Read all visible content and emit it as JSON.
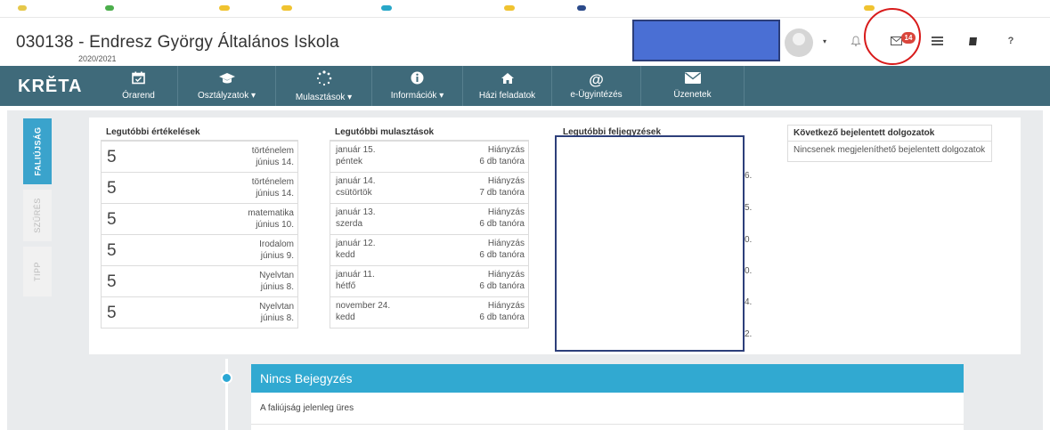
{
  "header": {
    "school_title": "030138 - Endresz György Általános Iskola",
    "school_year": "2020/2021",
    "avatar_caret": "▾",
    "message_badge": "14",
    "help_label": "?"
  },
  "nav": {
    "logo": "KRĔTA",
    "items": [
      {
        "label": "Órarend",
        "icon": "📅"
      },
      {
        "label": "Osztályzatok ▾",
        "icon": "🎓"
      },
      {
        "label": "Mulasztások ▾",
        "icon": "⁘"
      },
      {
        "label": "Információk ▾",
        "icon": "ℹ"
      },
      {
        "label": "Házi feladatok",
        "icon": "⌂"
      },
      {
        "label": "e-Ügyintézés",
        "icon": "@"
      },
      {
        "label": "Üzenetek",
        "icon": "✉"
      }
    ]
  },
  "sidetabs": {
    "active": "FALIÚJSÁG",
    "second": "SZŰRÉS",
    "third": "TIPP"
  },
  "grades": {
    "title": "Legutóbbi értékelések",
    "rows": [
      {
        "grade": "5",
        "subject": "történelem",
        "date": "június 14."
      },
      {
        "grade": "5",
        "subject": "történelem",
        "date": "június 14."
      },
      {
        "grade": "5",
        "subject": "matematika",
        "date": "június 10."
      },
      {
        "grade": "5",
        "subject": "Irodalom",
        "date": "június 9."
      },
      {
        "grade": "5",
        "subject": "Nyelvtan",
        "date": "június 8."
      },
      {
        "grade": "5",
        "subject": "Nyelvtan",
        "date": "június 8."
      }
    ]
  },
  "absences": {
    "title": "Legutóbbi mulasztások",
    "rows": [
      {
        "date": "január 15.",
        "day": "péntek",
        "status": "Hiányzás",
        "count": "6 db tanóra"
      },
      {
        "date": "január 14.",
        "day": "csütörtök",
        "status": "Hiányzás",
        "count": "7 db tanóra"
      },
      {
        "date": "január 13.",
        "day": "szerda",
        "status": "Hiányzás",
        "count": "6 db tanóra"
      },
      {
        "date": "január 12.",
        "day": "kedd",
        "status": "Hiányzás",
        "count": "6 db tanóra"
      },
      {
        "date": "január 11.",
        "day": "hétfő",
        "status": "Hiányzás",
        "count": "6 db tanóra"
      },
      {
        "date": "november 24.",
        "day": "kedd",
        "status": "Hiányzás",
        "count": "6 db tanóra"
      }
    ]
  },
  "notes": {
    "title": "Legutóbbi feljegyzések",
    "fragments": [
      "6.",
      "5.",
      "0.",
      "0.",
      "4.",
      "2."
    ]
  },
  "exams": {
    "title": "Következő bejelentett dolgozatok",
    "empty_text": "Nincsenek megjeleníthető bejelentett dolgozatok"
  },
  "timeline": {
    "entry_title": "Nincs Bejegyzés",
    "entry_body": "A faliújság jelenleg üres"
  }
}
